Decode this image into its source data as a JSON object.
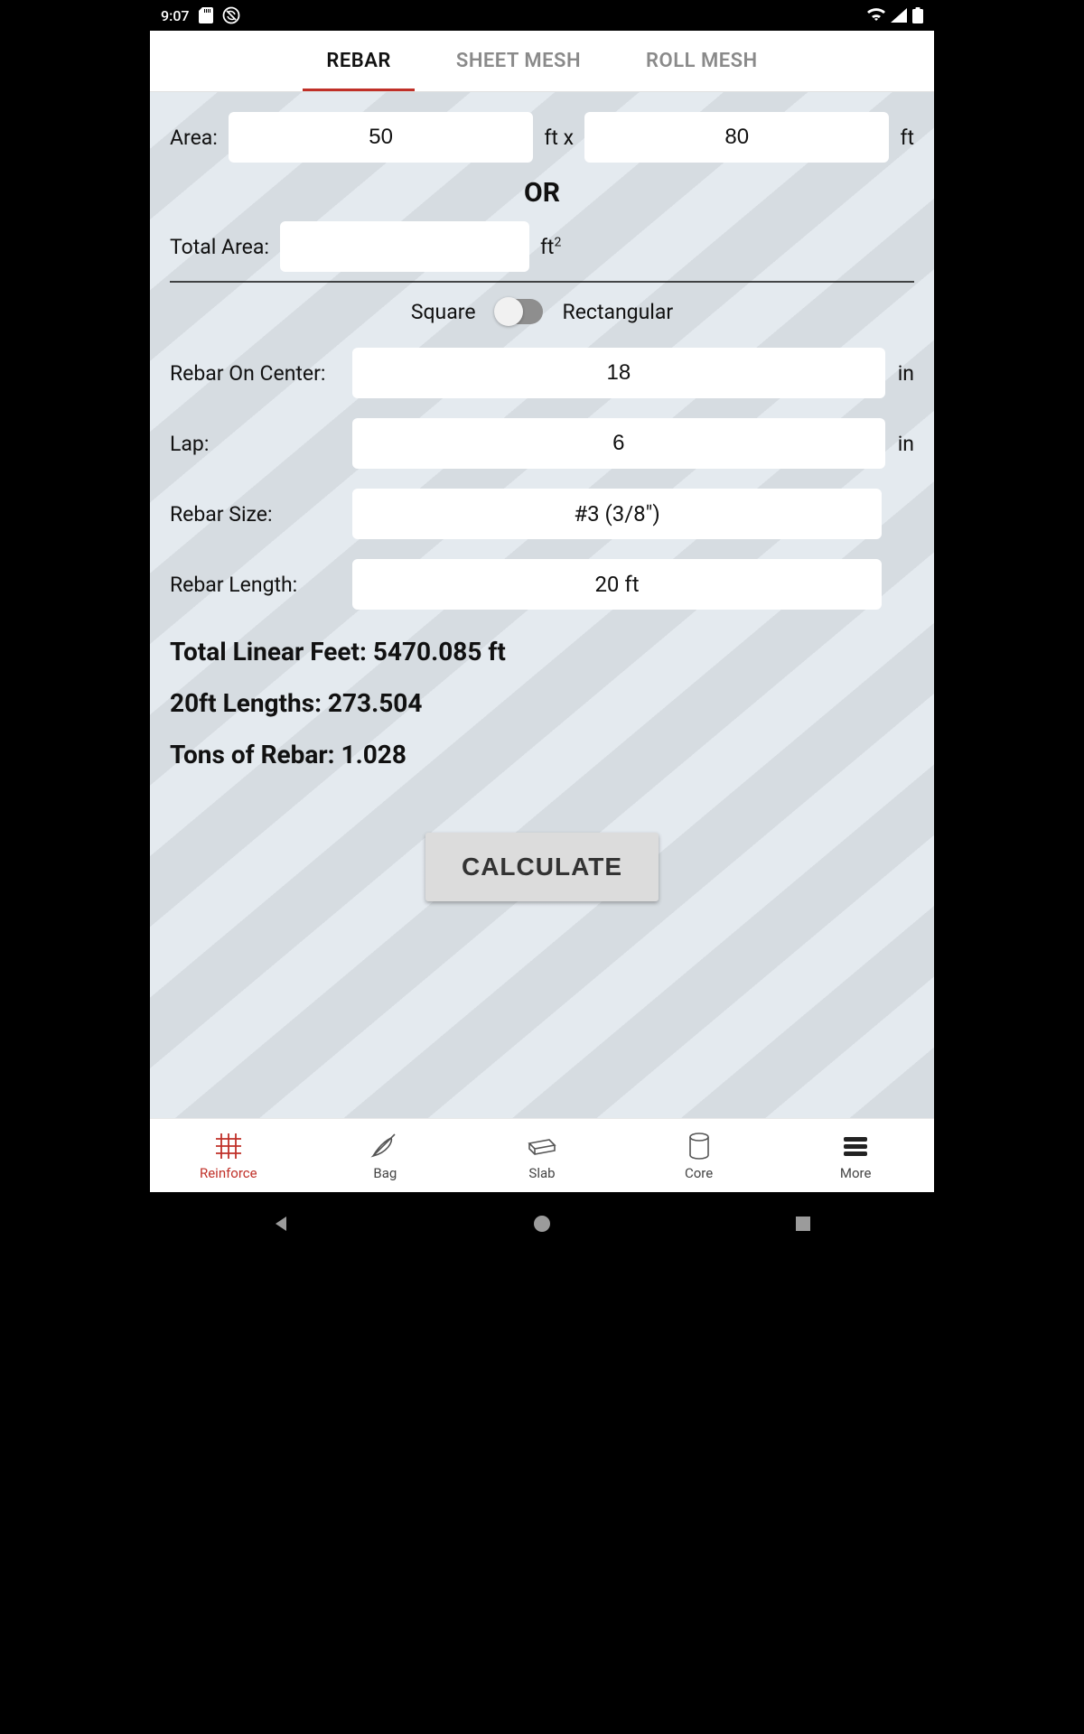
{
  "status": {
    "time": "9:07"
  },
  "tabs": {
    "rebar": "REBAR",
    "sheet_mesh": "SHEET MESH",
    "roll_mesh": "ROLL MESH",
    "active": "rebar"
  },
  "area": {
    "label": "Area:",
    "width_value": "50",
    "width_unit": "ft x",
    "length_value": "80",
    "length_unit": "ft"
  },
  "or_label": "OR",
  "total_area": {
    "label": "Total Area:",
    "value": "",
    "unit_html": "ft²"
  },
  "shape": {
    "square_label": "Square",
    "rect_label": "Rectangular",
    "state": "square"
  },
  "fields": {
    "rebar_on_center": {
      "label": "Rebar On Center:",
      "value": "18",
      "unit": "in"
    },
    "lap": {
      "label": "Lap:",
      "value": "6",
      "unit": "in"
    },
    "rebar_size": {
      "label": "Rebar Size:",
      "value": "#3 (3/8\")"
    },
    "rebar_length": {
      "label": "Rebar Length:",
      "value": "20 ft"
    }
  },
  "results": {
    "total_linear_feet": "Total Linear Feet: 5470.085 ft",
    "lengths": "20ft Lengths: 273.504",
    "tons": "Tons of Rebar: 1.028"
  },
  "calculate_label": "CALCULATE",
  "nav": {
    "reinforce": "Reinforce",
    "bag": "Bag",
    "slab": "Slab",
    "core": "Core",
    "more": "More",
    "active": "reinforce"
  }
}
